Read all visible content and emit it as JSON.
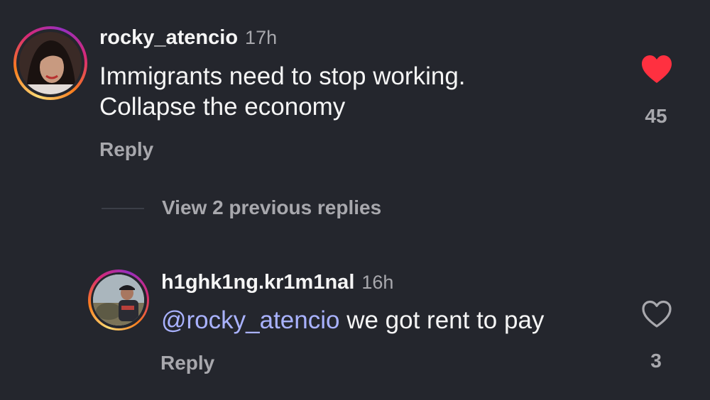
{
  "comments": [
    {
      "username": "rocky_atencio",
      "time": "17h",
      "text_lines": [
        "Immigrants need to stop working.",
        "Collapse the economy"
      ],
      "reply_label": "Reply",
      "likes": "45",
      "liked": true,
      "like_icon": "heart-filled-icon",
      "like_color": "#ff3040"
    }
  ],
  "thread": {
    "view_replies_label": "View 2 previous replies"
  },
  "replies": [
    {
      "username": "h1ghk1ng.kr1m1nal",
      "time": "16h",
      "mention": "@rocky_atencio",
      "text": " we got rent to pay",
      "reply_label": "Reply",
      "likes": "3",
      "liked": false,
      "like_icon": "heart-outline-icon"
    }
  ],
  "colors": {
    "background": "#24262d",
    "secondary_text": "#a8a8ad",
    "mention": "#a9b2ff"
  }
}
